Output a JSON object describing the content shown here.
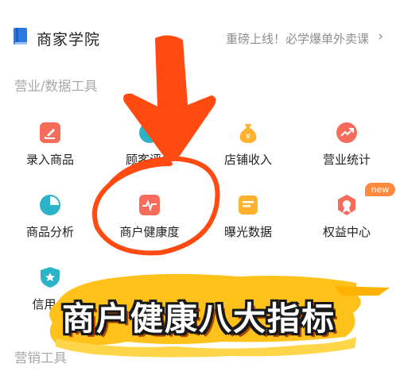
{
  "header": {
    "title": "商家学院",
    "promo_text": "重磅上线！必学爆单外卖课",
    "book_icon": "book-icon",
    "chevron_icon": "chevron-right-icon"
  },
  "sections": {
    "data_tools_title": "营业/数据工具",
    "marketing_tools_title": "营销工具"
  },
  "tools": [
    {
      "label": "录入商品",
      "icon": "edit-icon",
      "color": "#f76b5a"
    },
    {
      "label": "顾客评价",
      "icon": "customer-review-icon",
      "color": "#2bb3c8"
    },
    {
      "label": "店铺收入",
      "icon": "money-bag-icon",
      "color": "#ffb22e"
    },
    {
      "label": "营业统计",
      "icon": "trend-up-icon",
      "color": "#f76b5a"
    },
    {
      "label": "商品分析",
      "icon": "pie-chart-icon",
      "color": "#2bb3c8"
    },
    {
      "label": "商户健康度",
      "icon": "pulse-icon",
      "color": "#f76b5a"
    },
    {
      "label": "曝光数据",
      "icon": "document-icon",
      "color": "#ffb22e"
    },
    {
      "label": "权益中心",
      "icon": "badge-medal-icon",
      "color": "#f76b5a"
    },
    {
      "label": "信用分",
      "icon": "shield-star-icon",
      "color": "#2bb3c8"
    }
  ],
  "new_badge": "new",
  "overlay": {
    "banner_text": "商户健康八大指标",
    "arrow_color": "#ff4a12",
    "circle_color": "#ff4a12",
    "brush_color": "#ffc21a"
  }
}
